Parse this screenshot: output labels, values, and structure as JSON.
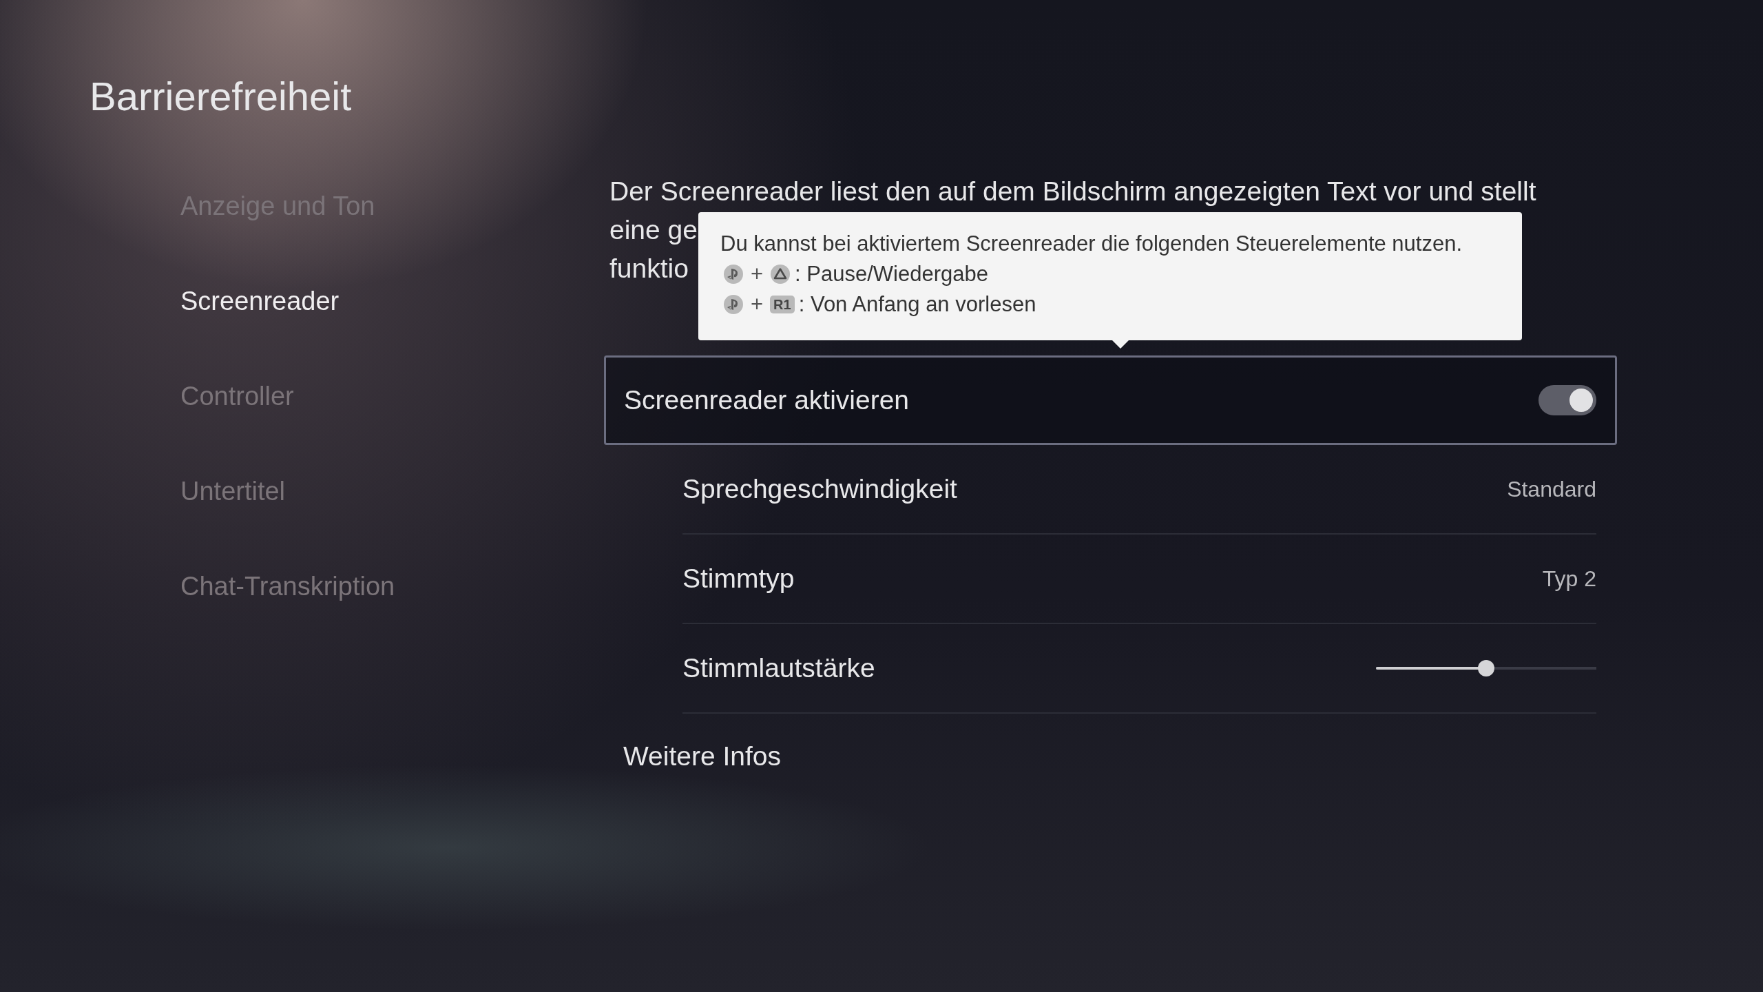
{
  "title": "Barrierefreiheit",
  "sidebar": {
    "items": [
      {
        "label": "Anzeige und Ton",
        "selected": false
      },
      {
        "label": "Screenreader",
        "selected": true
      },
      {
        "label": "Controller",
        "selected": false
      },
      {
        "label": "Untertitel",
        "selected": false
      },
      {
        "label": "Chat-Transkription",
        "selected": false
      }
    ]
  },
  "description": {
    "lines": [
      "Der Screenreader liest den auf dem Bildschirm angezeigten Text vor und stellt",
      "eine ge",
      "funktio"
    ]
  },
  "tooltip": {
    "text": "Du kannst bei aktiviertem Screenreader die folgenden Steuerelemente nutzen.",
    "lines": [
      {
        "keys": [
          {
            "kind": "ps"
          },
          {
            "kind": "triangle"
          }
        ],
        "plus": "+",
        "action": ": Pause/Wiedergabe"
      },
      {
        "keys": [
          {
            "kind": "ps"
          },
          {
            "kind": "label",
            "text": "R1"
          }
        ],
        "plus": "+",
        "action": ": Von Anfang an vorlesen"
      }
    ]
  },
  "settings": [
    {
      "kind": "toggle",
      "label": "Screenreader aktivieren",
      "on": true,
      "selected": true
    },
    {
      "kind": "value",
      "label": "Sprechgeschwindigkeit",
      "value": "Standard",
      "selected": false
    },
    {
      "kind": "value",
      "label": "Stimmtyp",
      "value": "Typ 2",
      "selected": false
    },
    {
      "kind": "slider",
      "label": "Stimmlautstärke",
      "level": 0.5,
      "selected": false
    }
  ],
  "more_link": "Weitere Infos"
}
